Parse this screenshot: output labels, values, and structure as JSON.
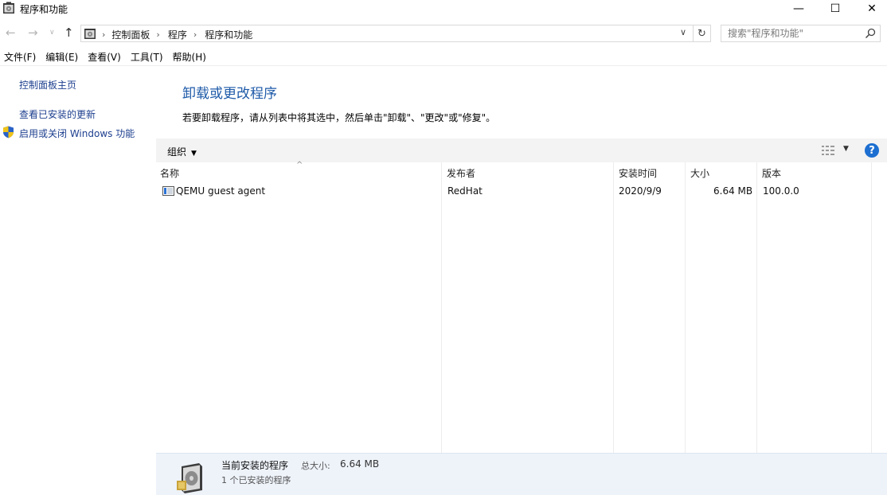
{
  "window": {
    "title": "程序和功能",
    "minimize": "—",
    "maximize": "☐",
    "close": "✕"
  },
  "navigation": {
    "back": "←",
    "forward": "→",
    "recent": "∨",
    "up": "↑",
    "breadcrumb": [
      "控制面板",
      "程序",
      "程序和功能"
    ],
    "dropdown": "∨",
    "refresh": "↻",
    "search_placeholder": "搜索\"程序和功能\""
  },
  "menu": [
    "文件(F)",
    "编辑(E)",
    "查看(V)",
    "工具(T)",
    "帮助(H)"
  ],
  "left_pane": {
    "home": "控制面板主页",
    "updates": "查看已安装的更新",
    "features": "启用或关闭 Windows 功能"
  },
  "main": {
    "heading": "卸载或更改程序",
    "description": "若要卸载程序，请从列表中将其选中，然后单击\"卸载\"、\"更改\"或\"修复\"。"
  },
  "toolbar": {
    "organize": "组织",
    "organize_caret": "▼",
    "view_caret": "▼",
    "help": "?"
  },
  "table": {
    "sort_indicator": "^",
    "columns": [
      "名称",
      "发布者",
      "安装时间",
      "大小",
      "版本"
    ],
    "rows": [
      {
        "name": "QEMU guest agent",
        "publisher": "RedHat",
        "installed": "2020/9/9",
        "size": "6.64 MB",
        "version": "100.0.0"
      }
    ]
  },
  "details": {
    "title": "当前安装的程序",
    "total_label": "总大小:",
    "total_value": "6.64 MB",
    "count": "1 个已安装的程序"
  },
  "colors": {
    "link": "#1d3f8f",
    "heading": "#1e5aa8",
    "help_badge": "#1d6fd1",
    "details_bg": "#eef3fa"
  }
}
